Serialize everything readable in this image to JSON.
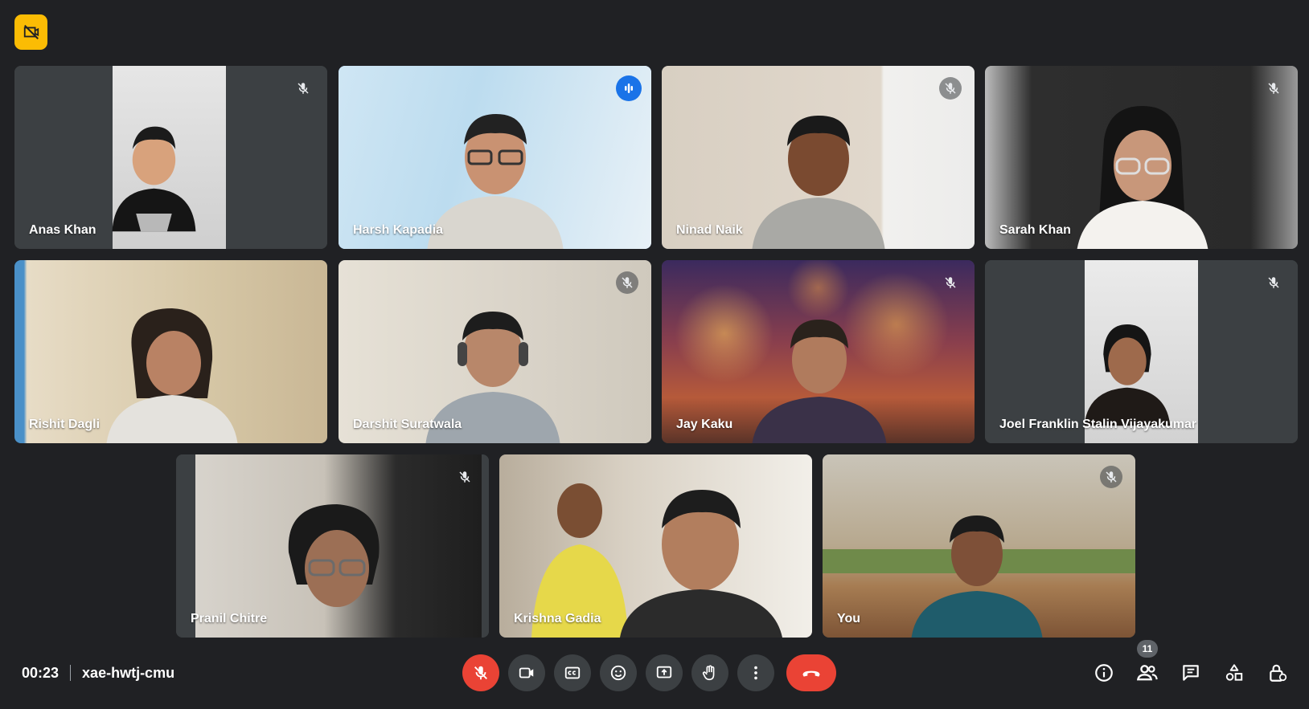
{
  "meeting": {
    "elapsed": "00:23",
    "code": "xae-hwtj-cmu",
    "participant_count": "11"
  },
  "participants": [
    {
      "name": "Anas Khan",
      "muted": true,
      "speaking": false
    },
    {
      "name": "Harsh Kapadia",
      "muted": false,
      "speaking": true
    },
    {
      "name": "Ninad Naik",
      "muted": true,
      "speaking": false
    },
    {
      "name": "Sarah Khan",
      "muted": true,
      "speaking": false
    },
    {
      "name": "Rishit Dagli",
      "muted": false,
      "speaking": false
    },
    {
      "name": "Darshit Suratwala",
      "muted": true,
      "speaking": false
    },
    {
      "name": "Jay Kaku",
      "muted": true,
      "speaking": false
    },
    {
      "name": "Joel Franklin Stalin Vijayakumar",
      "muted": true,
      "speaking": false
    },
    {
      "name": "Pranil Chitre",
      "muted": true,
      "speaking": false
    },
    {
      "name": "Krishna Gadia",
      "muted": false,
      "speaking": false
    },
    {
      "name": "You",
      "muted": true,
      "speaking": false
    }
  ],
  "controls": [
    {
      "icon": "mic-off-icon"
    },
    {
      "icon": "camera-icon"
    },
    {
      "icon": "captions-icon"
    },
    {
      "icon": "emoji-icon"
    },
    {
      "icon": "present-screen-icon"
    },
    {
      "icon": "raise-hand-icon"
    },
    {
      "icon": "more-options-icon"
    },
    {
      "icon": "hang-up-icon"
    }
  ],
  "right_tools": [
    {
      "icon": "info-icon"
    },
    {
      "icon": "people-icon"
    },
    {
      "icon": "chat-icon"
    },
    {
      "icon": "activities-icon"
    },
    {
      "icon": "host-controls-icon"
    }
  ],
  "colors": {
    "background": "#202124",
    "tile": "#3c4043",
    "accent": "#8ab4f8",
    "danger": "#ea4335",
    "badge": "#fbbc04"
  }
}
